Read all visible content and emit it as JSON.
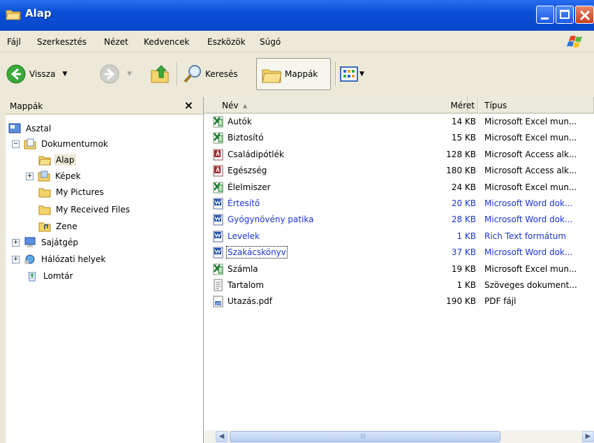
{
  "window": {
    "title": "Alap"
  },
  "menu": [
    "Fájl",
    "Szerkesztés",
    "Nézet",
    "Kedvencek",
    "Eszközök",
    "Súgó"
  ],
  "toolbar": {
    "back_label": "Vissza",
    "search_label": "Keresés",
    "folders_label": "Mappák"
  },
  "folder_pane": {
    "title": "Mappák",
    "close_glyph": "×"
  },
  "tree": [
    {
      "label": "Asztal",
      "icon": "desktop-icon"
    },
    {
      "label": "Dokumentumok",
      "icon": "documents-folder-icon",
      "expander": "⊟"
    },
    {
      "label": "Alap",
      "icon": "folder-open-icon"
    },
    {
      "label": "Képek",
      "icon": "pictures-folder-icon",
      "expander": "⊞"
    },
    {
      "label": "My Pictures",
      "icon": "folder-icon"
    },
    {
      "label": "My Received Files",
      "icon": "folder-icon"
    },
    {
      "label": "Zene",
      "icon": "music-folder-icon"
    },
    {
      "label": "Sajátgép",
      "icon": "computer-icon",
      "expander": "⊞"
    },
    {
      "label": "Hálózati helyek",
      "icon": "network-icon",
      "expander": "⊞"
    },
    {
      "label": "Lomtár",
      "icon": "recycle-bin-icon"
    }
  ],
  "columns": {
    "name": "Név",
    "sort_arrow": "▲",
    "size": "Méret",
    "type": "Típus"
  },
  "files": [
    {
      "name": "Autók",
      "size": "14 KB",
      "type": "Microsoft Excel mun...",
      "icon": "excel-icon"
    },
    {
      "name": "Biztosító",
      "size": "15 KB",
      "type": "Microsoft Excel mun...",
      "icon": "excel-icon"
    },
    {
      "name": "Családipótlék",
      "size": "128 KB",
      "type": "Microsoft Access alk...",
      "icon": "access-icon"
    },
    {
      "name": "Egészség",
      "size": "180 KB",
      "type": "Microsoft Access alk...",
      "icon": "access-icon"
    },
    {
      "name": "Élelmiszer",
      "size": "24 KB",
      "type": "Microsoft Excel mun...",
      "icon": "excel-icon"
    },
    {
      "name": "Értesítő",
      "size": "20 KB",
      "type": "Microsoft Word dok...",
      "icon": "word-icon",
      "compressed": true
    },
    {
      "name": "Gyógynövény patika",
      "size": "28 KB",
      "type": "Microsoft Word dok...",
      "icon": "word-icon",
      "compressed": true
    },
    {
      "name": "Levelek",
      "size": "1 KB",
      "type": "Rich Text formátum",
      "icon": "word-icon",
      "compressed": true
    },
    {
      "name": "Szakácskönyv",
      "size": "37 KB",
      "type": "Microsoft Word dok...",
      "icon": "word-icon",
      "compressed": true,
      "focused": true
    },
    {
      "name": "Számla",
      "size": "19 KB",
      "type": "Microsoft Excel mun...",
      "icon": "excel-icon"
    },
    {
      "name": "Tartalom",
      "size": "1 KB",
      "type": "Szöveges dokument...",
      "icon": "text-file-icon"
    },
    {
      "name": "Utazás.pdf",
      "size": "190 KB",
      "type": "PDF fájl",
      "icon": "pdf-icon"
    }
  ],
  "colors": {
    "titlebar": "#0a4fd8",
    "chrome": "#ece9d8",
    "compressed_text": "#1c33d4"
  },
  "scrollbar": {
    "left_glyph": "◀",
    "right_glyph": "▶",
    "grip": "|||"
  }
}
